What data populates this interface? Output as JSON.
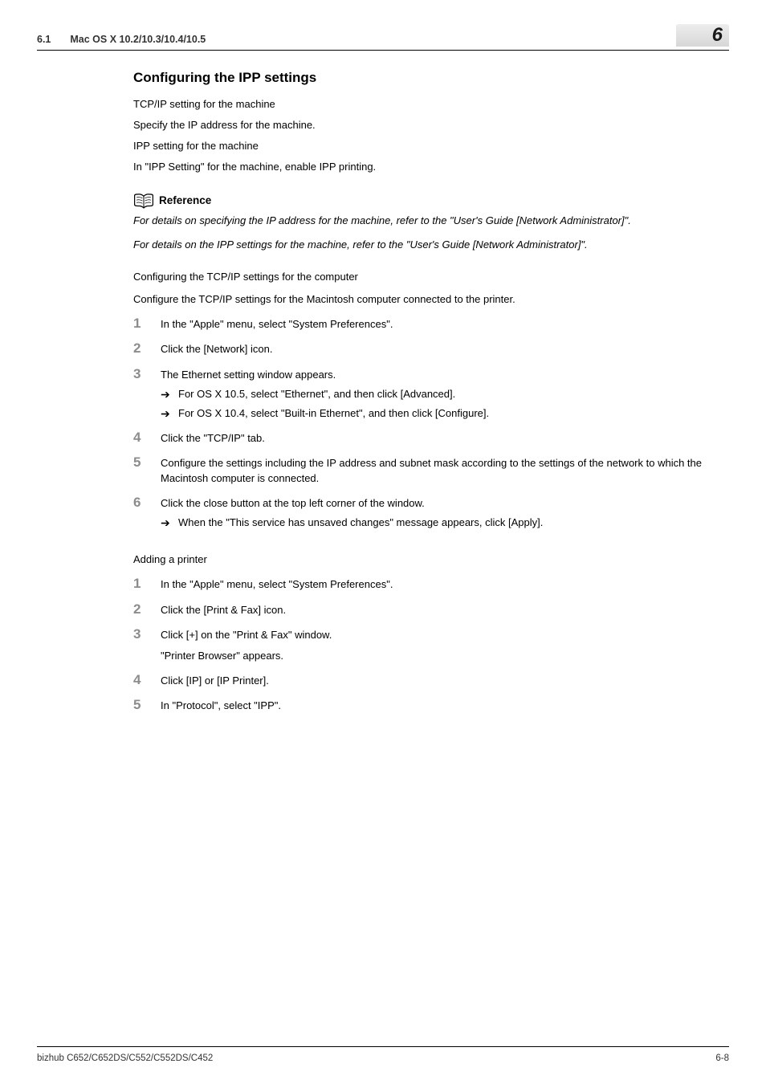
{
  "header": {
    "section_number": "6.1",
    "section_title": "Mac OS X 10.2/10.3/10.4/10.5",
    "chapter_number": "6"
  },
  "main": {
    "title": "Configuring the IPP settings",
    "intro_paras": [
      "TCP/IP setting for the machine",
      "Specify the IP address for the machine.",
      "IPP setting for the machine",
      "In \"IPP Setting\" for the machine, enable IPP printing."
    ],
    "reference": {
      "label": "Reference",
      "items": [
        "For details on specifying the IP address for the machine, refer to the \"User's Guide [Network Administrator]\".",
        "For details on the IPP settings for the machine, refer to the \"User's Guide [Network Administrator]\"."
      ]
    },
    "tcpip": {
      "heading": "Configuring the TCP/IP settings for the computer",
      "intro": "Configure the TCP/IP settings for the Macintosh computer connected to the printer.",
      "steps": [
        {
          "n": "1",
          "text": "In the \"Apple\" menu, select \"System Preferences\"."
        },
        {
          "n": "2",
          "text": "Click the [Network] icon."
        },
        {
          "n": "3",
          "text": "The Ethernet setting window appears.",
          "subs": [
            "For OS X 10.5, select \"Ethernet\", and then click [Advanced].",
            "For OS X 10.4, select \"Built-in Ethernet\", and then click [Configure]."
          ]
        },
        {
          "n": "4",
          "text": "Click the \"TCP/IP\" tab."
        },
        {
          "n": "5",
          "text": "Configure the settings including the IP address and subnet mask according to the settings of the network to which the Macintosh computer is connected."
        },
        {
          "n": "6",
          "text": "Click the close button at the top left corner of the window.",
          "subs": [
            "When the \"This service has unsaved changes\" message appears, click [Apply]."
          ]
        }
      ]
    },
    "adding": {
      "heading": "Adding a printer",
      "steps": [
        {
          "n": "1",
          "text": "In the \"Apple\" menu, select \"System Preferences\"."
        },
        {
          "n": "2",
          "text": "Click the [Print & Fax] icon."
        },
        {
          "n": "3",
          "text": "Click [+] on the \"Print & Fax\" window.",
          "after": "\"Printer Browser\" appears."
        },
        {
          "n": "4",
          "text": "Click [IP] or [IP Printer]."
        },
        {
          "n": "5",
          "text": "In \"Protocol\", select \"IPP\"."
        }
      ]
    }
  },
  "footer": {
    "left": "bizhub C652/C652DS/C552/C552DS/C452",
    "right": "6-8"
  }
}
